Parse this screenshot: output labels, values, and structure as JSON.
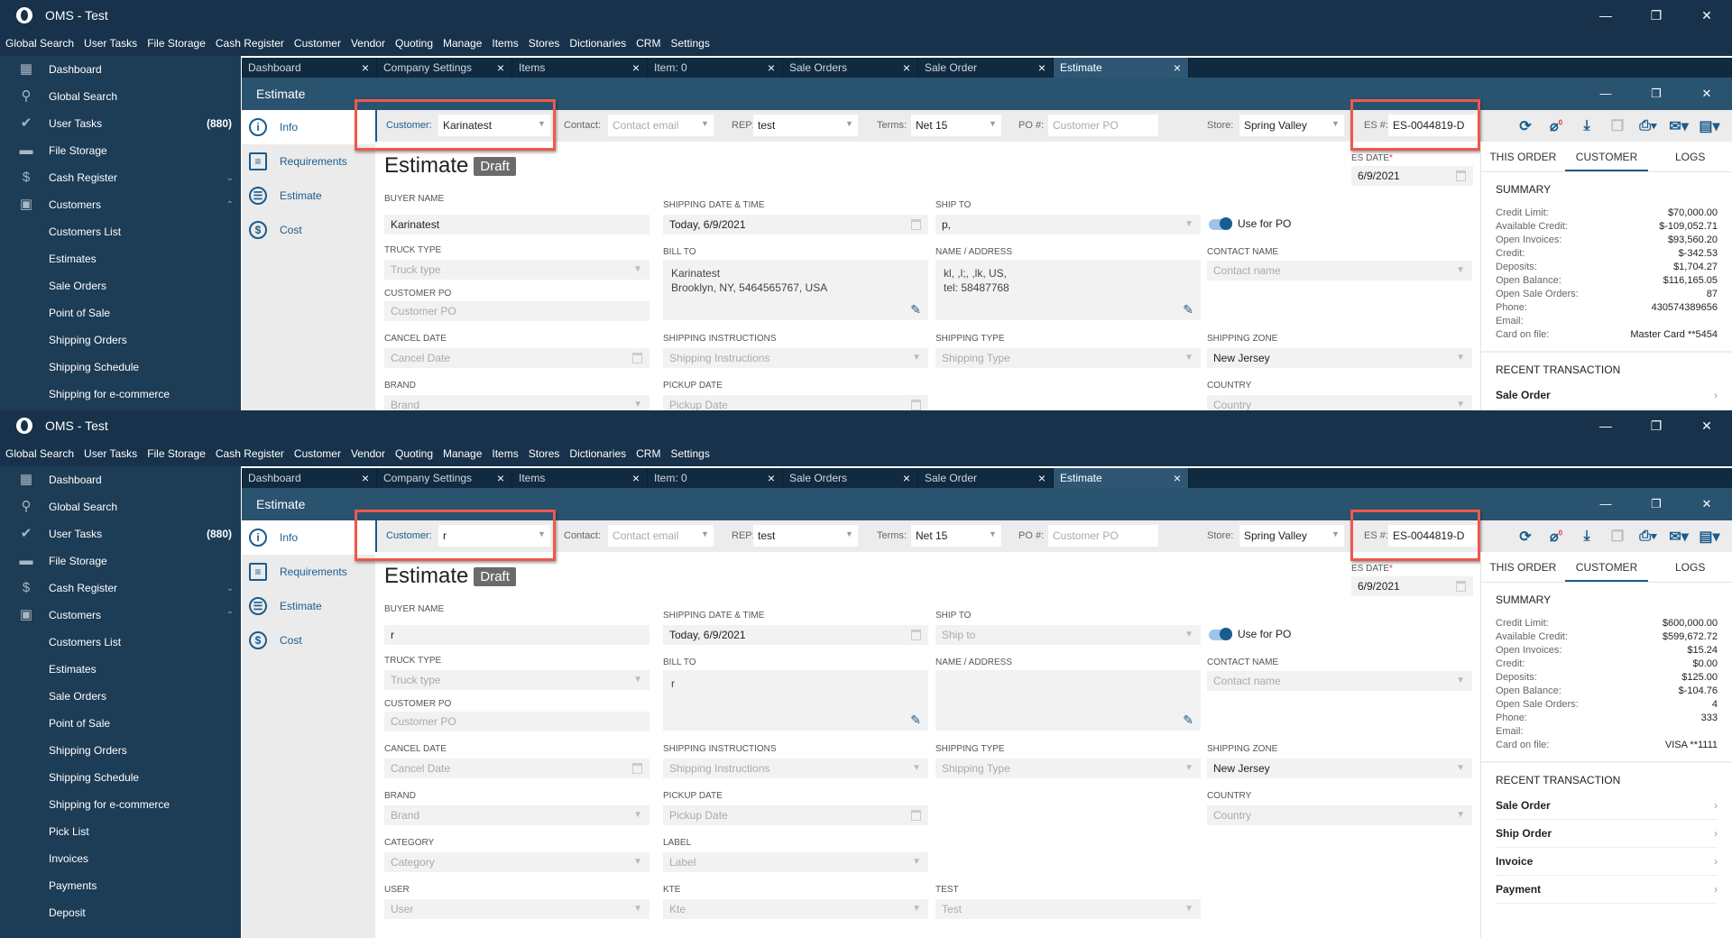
{
  "app": {
    "title": "OMS - Test",
    "minimize": "—",
    "restore": "❐",
    "close": "✕"
  },
  "menu": [
    "Global Search",
    "User Tasks",
    "File Storage",
    "Cash Register",
    "Customer",
    "Vendor",
    "Quoting",
    "Manage",
    "Items",
    "Stores",
    "Dictionaries",
    "CRM",
    "Settings"
  ],
  "sidebar": [
    {
      "label": "Dashboard",
      "icon": "dashboard-icon",
      "glyph": "▦"
    },
    {
      "label": "Global Search",
      "icon": "search-icon",
      "glyph": "⚲"
    },
    {
      "label": "User Tasks",
      "icon": "check-icon",
      "glyph": "✔",
      "count": "(880)"
    },
    {
      "label": "File Storage",
      "icon": "folder-icon",
      "glyph": "▬"
    },
    {
      "label": "Cash Register",
      "icon": "dollar-icon",
      "glyph": "$",
      "chevron": "⌄"
    },
    {
      "label": "Customers",
      "icon": "person-icon",
      "glyph": "▣",
      "chevron": "⌃"
    },
    {
      "label": "Customers List",
      "sub": true
    },
    {
      "label": "Estimates",
      "sub": true
    },
    {
      "label": "Sale Orders",
      "sub": true
    },
    {
      "label": "Point of Sale",
      "sub": true
    },
    {
      "label": "Shipping Orders",
      "sub": true
    },
    {
      "label": "Shipping Schedule",
      "sub": true
    },
    {
      "label": "Shipping for e-commerce",
      "sub": true
    },
    {
      "label": "Pick List",
      "sub": true
    },
    {
      "label": "Invoices",
      "sub": true
    },
    {
      "label": "Payments",
      "sub": true
    },
    {
      "label": "Deposit",
      "sub": true
    }
  ],
  "tabs": [
    {
      "label": "Dashboard"
    },
    {
      "label": "Company Settings"
    },
    {
      "label": "Items"
    },
    {
      "label": "Item: 0"
    },
    {
      "label": "Sale Orders"
    },
    {
      "label": "Sale Order"
    },
    {
      "label": "Estimate",
      "active": true
    }
  ],
  "estimate_header": "Estimate",
  "subnav": [
    {
      "label": "Info",
      "icon": "info-icon",
      "glyph": "i",
      "active": true
    },
    {
      "label": "Requirements",
      "icon": "clipboard-icon",
      "glyph": "≡"
    },
    {
      "label": "Estimate",
      "icon": "list-icon",
      "glyph": "☰"
    },
    {
      "label": "Cost",
      "icon": "dollar-icon",
      "glyph": "$"
    }
  ],
  "labels": {
    "customer": "Customer:",
    "contact": "Contact:",
    "rep": "REP:",
    "terms": "Terms:",
    "po": "PO #:",
    "store": "Store:",
    "es": "ES #:",
    "heading": "Estimate",
    "draft": "Draft",
    "es_date": "ES DATE",
    "required": "*",
    "buyer_name": "BUYER NAME",
    "ship_date": "SHIPPING DATE & TIME",
    "ship_to": "SHIP TO",
    "use_for_po": "Use for PO",
    "truck_type": "TRUCK TYPE",
    "bill_to": "BILL TO",
    "name_address": "NAME / ADDRESS",
    "contact_name": "CONTACT NAME",
    "customer_po": "CUSTOMER PO",
    "cancel_date": "CANCEL DATE",
    "ship_instr": "SHIPPING INSTRUCTIONS",
    "ship_type": "SHIPPING TYPE",
    "ship_zone": "SHIPPING ZONE",
    "brand": "BRAND",
    "pickup_date": "PICKUP DATE",
    "country": "COUNTRY",
    "category": "CATEGORY",
    "label": "LABEL",
    "user": "USER",
    "kte": "KTE",
    "test": "TEST"
  },
  "placeholders": {
    "contact": "Contact email",
    "po": "Customer PO",
    "truck_type": "Truck type",
    "customer_po": "Customer PO",
    "contact_name": "Contact name",
    "cancel_date": "Cancel Date",
    "ship_instr": "Shipping Instructions",
    "ship_type": "Shipping Type",
    "brand": "Brand",
    "pickup_date": "Pickup Date",
    "country": "Country",
    "category": "Category",
    "label": "Label",
    "user": "User",
    "kte": "Kte",
    "test": "Test",
    "ship_to": "Ship to"
  },
  "right_tabs": [
    "THIS ORDER",
    "CUSTOMER",
    "LOGS"
  ],
  "summary_title": "SUMMARY",
  "summary_keys": [
    "Credit Limit:",
    "Available Credit:",
    "Open Invoices:",
    "Credit:",
    "Deposits:",
    "Open Balance:",
    "Open Sale Orders:",
    "Phone:",
    "Email:",
    "Card on file:"
  ],
  "recent_title": "RECENT TRANSACTION",
  "recent": [
    "Sale Order",
    "Ship Order",
    "Invoice",
    "Payment"
  ],
  "highlight_color": "#f0584b",
  "windows": [
    {
      "customer": "Karinatest",
      "rep": "test",
      "terms": "Net 15",
      "store": "Spring Valley",
      "es_number": "ES-0044819-D",
      "es_date": "6/9/2021",
      "buyer_name": "Karinatest",
      "ship_date": "Today, 6/9/2021",
      "ship_to": "p,",
      "bill_to": [
        "Karinatest",
        "Brooklyn, NY, 5464565767, USA"
      ],
      "name_address": [
        "kl, ,l;, ,lk, US,",
        "tel: 58487768"
      ],
      "ship_zone": "New Jersey",
      "summary": [
        "$70,000.00",
        "$-109,052.71",
        "$93,560.20",
        "$-342.53",
        "$1,704.27",
        "$116,165.05",
        "87",
        "430574389656",
        "",
        "Master Card **5454"
      ]
    },
    {
      "customer": "r",
      "rep": "test",
      "terms": "Net 15",
      "store": "Spring Valley",
      "es_number": "ES-0044819-D",
      "es_date": "6/9/2021",
      "buyer_name": "r",
      "ship_date": "Today, 6/9/2021",
      "ship_to": "",
      "bill_to": [
        "r",
        ""
      ],
      "name_address": [
        "",
        ""
      ],
      "ship_zone": "New Jersey",
      "summary": [
        "$600,000.00",
        "$599,672.72",
        "$15.24",
        "$0.00",
        "$125.00",
        "$-104.76",
        "4",
        "333",
        "",
        "VISA **1111"
      ]
    }
  ]
}
